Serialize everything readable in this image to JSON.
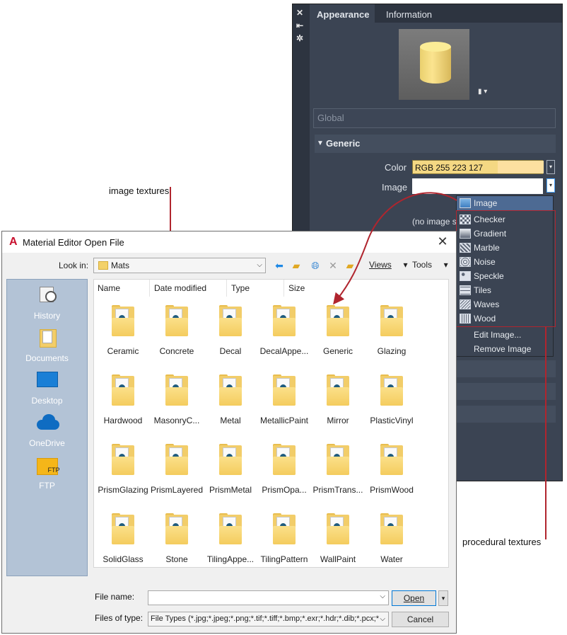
{
  "annotations": {
    "image_textures": "image textures",
    "procedural_textures": "procedural textures"
  },
  "material_panel": {
    "strip_icons": [
      "close-icon",
      "collapse-icon",
      "settings-icon"
    ],
    "tabs": [
      "Appearance",
      "Information"
    ],
    "active_tab": "Appearance",
    "global_field": "Global",
    "section": "Generic",
    "color_label": "Color",
    "color_value": "RGB 255 223 127",
    "image_label": "Image",
    "no_image_text": "(no image s"
  },
  "image_menu": {
    "top_item": "Image",
    "procedural_items": [
      "Checker",
      "Gradient",
      "Marble",
      "Noise",
      "Speckle",
      "Tiles",
      "Waves",
      "Wood"
    ],
    "actions": [
      "Edit Image...",
      "Remove Image"
    ]
  },
  "dialog": {
    "title": "Material Editor Open File",
    "look_in_label": "Look in:",
    "look_in_value": "Mats",
    "views_label": "Views",
    "tools_label": "Tools",
    "places": [
      "History",
      "Documents",
      "Desktop",
      "OneDrive",
      "FTP"
    ],
    "columns": [
      "Name",
      "Date modified",
      "Type",
      "Size"
    ],
    "files": [
      "Ceramic",
      "Concrete",
      "Decal",
      "DecalAppe...",
      "Generic",
      "Glazing",
      "Hardwood",
      "MasonryC...",
      "Metal",
      "MetallicPaint",
      "Mirror",
      "PlasticVinyl",
      "PrismGlazing",
      "PrismLayered",
      "PrismMetal",
      "PrismOpa...",
      "PrismTrans...",
      "PrismWood",
      "SolidGlass",
      "Stone",
      "TilingAppe...",
      "TilingPattern",
      "WallPaint",
      "Water"
    ],
    "file_name_label": "File name:",
    "file_name_value": "",
    "files_of_type_label": "Files of type:",
    "files_of_type_value": "File Types (*.jpg;*.jpeg;*.png;*.tif;*.tiff;*.bmp;*.exr;*.hdr;*.dib;*.pcx;*.g",
    "open_button": "Open",
    "cancel_button": "Cancel"
  },
  "colors": {
    "panel_bg": "#3b4453",
    "highlight": "#4d6a93",
    "annotation_red": "#b0252e",
    "material_yellow": "#f4d883",
    "places_bg": "#b3c3d6"
  }
}
